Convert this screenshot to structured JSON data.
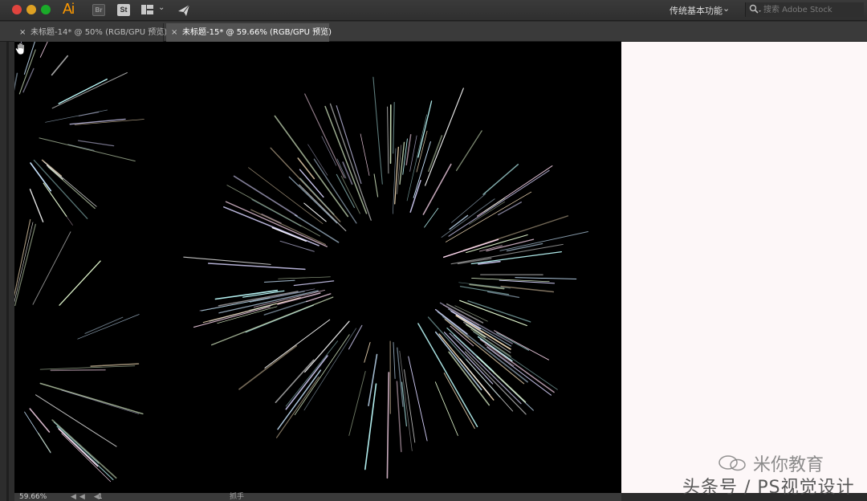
{
  "app": {
    "logo_text": "Ai",
    "bridge_label": "Br",
    "stock_label": "St",
    "workspace_name": "传统基本功能",
    "search_placeholder": "搜索 Adobe Stock"
  },
  "tabs": [
    {
      "label": "未标题-14* @ 50% (RGB/GPU 预览)",
      "active": false
    },
    {
      "label": "未标题-15* @ 59.66% (RGB/GPU 预览)",
      "active": true
    }
  ],
  "tab_close_glyph": "×",
  "status": {
    "zoom": "59.66%",
    "nav_glyphs": "◀◀ ◀",
    "page": "1",
    "tool": "抓手"
  },
  "watermark": {
    "line1": "米你教育",
    "line2": "头条号 / PS视觉设计"
  },
  "colors": {
    "accent_logo": "#ff9a00",
    "canvas": "#000000",
    "artboard_edge": "#fdf7f8",
    "ui_dark": "#2b2b2b"
  },
  "icons": {
    "hand_tool": "hand-icon",
    "search": "search-icon",
    "gpu": "rocket-icon"
  }
}
